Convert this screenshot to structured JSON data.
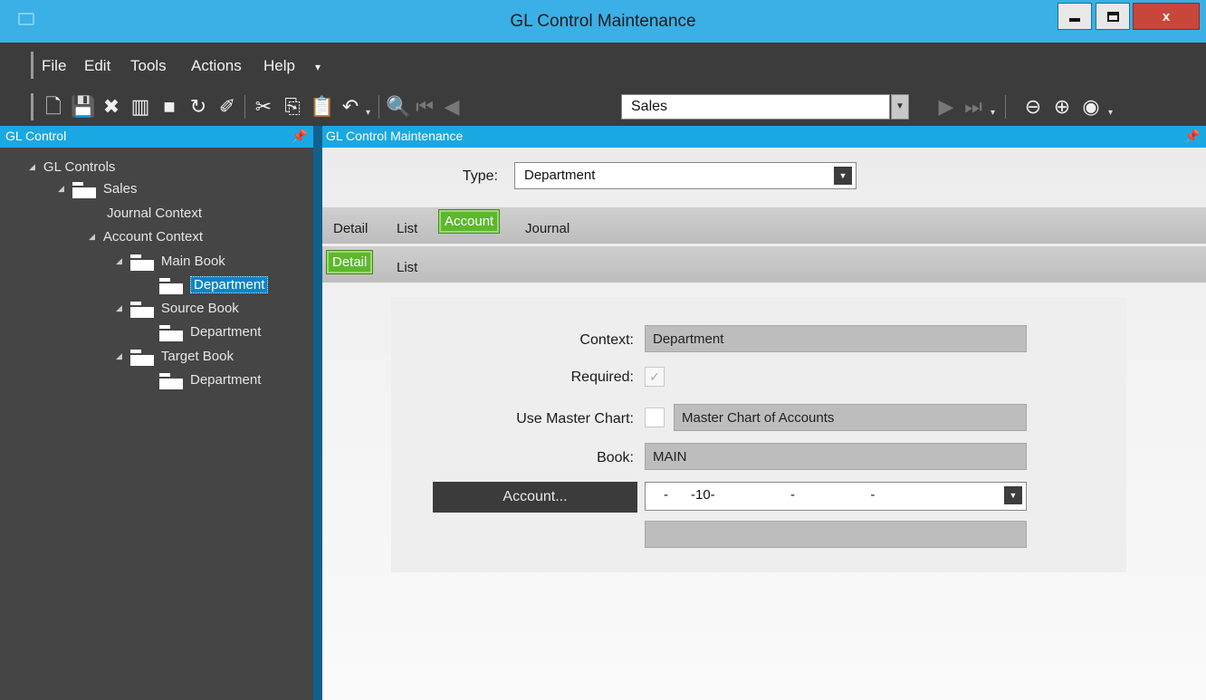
{
  "window": {
    "title": "GL Control Maintenance"
  },
  "menu": {
    "items": [
      "File",
      "Edit",
      "Tools",
      "Actions",
      "Help"
    ]
  },
  "toolbar": {
    "combo_value": "Sales"
  },
  "left_panel": {
    "title": "GL Control",
    "tree": {
      "root": "GL Controls",
      "sales": "Sales",
      "journal_context": "Journal Context",
      "account_context": "Account Context",
      "main_book": "Main Book",
      "main_book_dept": "Department",
      "source_book": "Source Book",
      "source_book_dept": "Department",
      "target_book": "Target Book",
      "target_book_dept": "Department"
    }
  },
  "main": {
    "title": "GL Control Maintenance",
    "type_label": "Type:",
    "type_value": "Department",
    "tabs": [
      "Detail",
      "List",
      "Account",
      "Journal"
    ],
    "subtabs": [
      "Detail",
      "List"
    ],
    "form": {
      "context_label": "Context:",
      "context_value": "Department",
      "required_label": "Required:",
      "required_checked": true,
      "use_master_label": "Use Master Chart:",
      "use_master_checked": false,
      "master_chart_value": "Master Chart of Accounts",
      "book_label": "Book:",
      "book_value": "MAIN",
      "account_button": "Account...",
      "account_value": "-      -10-                    -                    -",
      "account_description": ""
    }
  }
}
